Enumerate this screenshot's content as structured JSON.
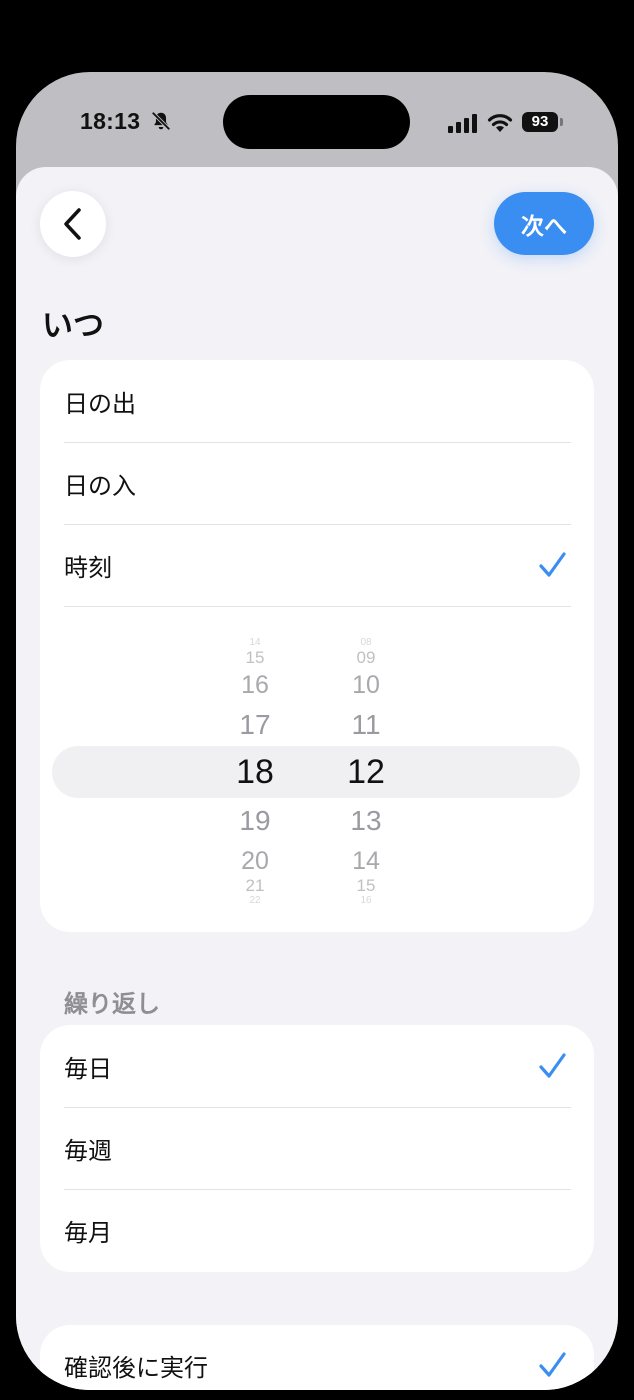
{
  "status": {
    "time": "18:13",
    "battery": "93"
  },
  "nav": {
    "next_label": "次へ"
  },
  "when": {
    "title": "いつ",
    "options": [
      "日の出",
      "日の入",
      "時刻"
    ],
    "selected": "時刻"
  },
  "picker": {
    "hours": [
      "14",
      "15",
      "16",
      "17",
      "18",
      "19",
      "20",
      "21",
      "22"
    ],
    "minutes": [
      "08",
      "09",
      "10",
      "11",
      "12",
      "13",
      "14",
      "15",
      "16"
    ],
    "selected_hour": "18",
    "selected_minute": "12"
  },
  "repeat": {
    "title": "繰り返し",
    "options": [
      "毎日",
      "毎週",
      "毎月"
    ],
    "selected": "毎日"
  },
  "confirm": {
    "label": "確認後に実行",
    "checked": true
  },
  "colors": {
    "accent": "#3a8ef2",
    "background": "#f2f2f7"
  }
}
